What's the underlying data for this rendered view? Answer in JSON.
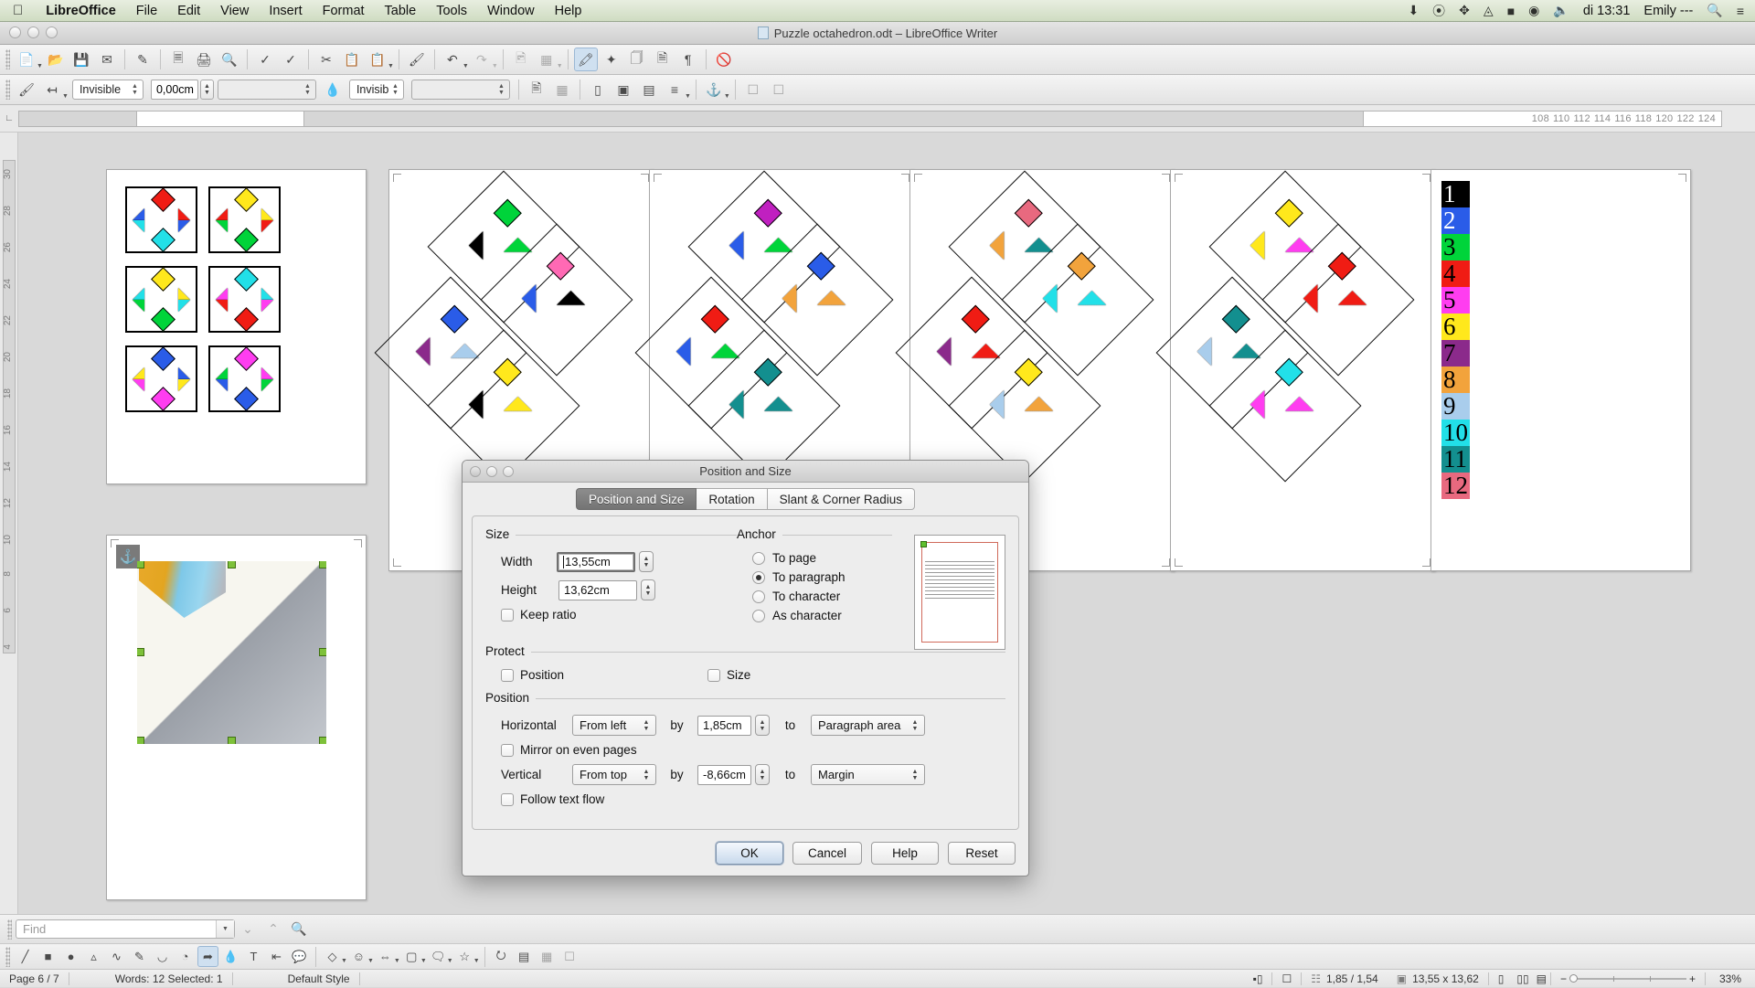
{
  "macmenu": {
    "apple": "apple-logo",
    "items": [
      "LibreOffice",
      "File",
      "Edit",
      "View",
      "Insert",
      "Format",
      "Table",
      "Tools",
      "Window",
      "Help"
    ],
    "tray_icons": [
      "download-icon",
      "dropbox-icon",
      "bluetooth-icon",
      "wifi-icon",
      "battery-icon",
      "clock-icon",
      "volume-icon"
    ],
    "clock": "di 13:31",
    "user": "Emily ---",
    "search_icon": "search-icon",
    "list_icon": "list-icon"
  },
  "window": {
    "title": "Puzzle octahedron.odt – LibreOffice Writer"
  },
  "toolbar2": {
    "line_style": "Invisible",
    "line_width": "0,00cm",
    "line_color": "",
    "area_style": "Invisib",
    "area_fill": ""
  },
  "ruler": {
    "ticks": [
      "108",
      "110",
      "112",
      "114",
      "116",
      "118",
      "120",
      "122",
      "124"
    ],
    "vticks": [
      "4",
      "6",
      "8",
      "10",
      "12",
      "14",
      "16",
      "18",
      "20",
      "22",
      "24",
      "26",
      "28",
      "30"
    ]
  },
  "numbers_column": [
    {
      "label": "1",
      "bg": "#000000",
      "fg": "#ffffff"
    },
    {
      "label": "2",
      "bg": "#2a5ce8",
      "fg": "#ffffff"
    },
    {
      "label": "3",
      "bg": "#00d43a",
      "fg": "#000000"
    },
    {
      "label": "4",
      "bg": "#f01c14",
      "fg": "#000000"
    },
    {
      "label": "5",
      "bg": "#ff3df0",
      "fg": "#000000"
    },
    {
      "label": "6",
      "bg": "#ffe81c",
      "fg": "#000000"
    },
    {
      "label": "7",
      "bg": "#8b2a8b",
      "fg": "#000000"
    },
    {
      "label": "8",
      "bg": "#f2a33c",
      "fg": "#000000"
    },
    {
      "label": "9",
      "bg": "#a9cdec",
      "fg": "#000000"
    },
    {
      "label": "10",
      "bg": "#22e0e8",
      "fg": "#000000"
    },
    {
      "label": "11",
      "bg": "#138f8f",
      "fg": "#000000"
    },
    {
      "label": "12",
      "bg": "#e8697f",
      "fg": "#000000"
    }
  ],
  "find": {
    "placeholder": "Find",
    "down_icon": "find-next-icon",
    "up_icon": "find-previous-icon",
    "dialog_icon": "find-and-replace-icon"
  },
  "statusbar": {
    "page": "Page 6 / 7",
    "words": "Words: 12 Selected: 1",
    "style": "Default Style",
    "selection_mode_icon": "selection-mode-icon",
    "modified_icon": "document-modified-icon",
    "position": "1,85 / 1,54",
    "size": "13,55 x 13,62",
    "view_single_icon": "single-page-view-icon",
    "view_multi_icon": "multi-page-view-icon",
    "view_book_icon": "book-view-icon",
    "zoom_minus": "−",
    "zoom_plus": "+",
    "zoom": "33%"
  },
  "dialog": {
    "title": "Position and Size",
    "tabs": [
      {
        "label": "Position and Size",
        "selected": true
      },
      {
        "label": "Rotation",
        "selected": false
      },
      {
        "label": "Slant & Corner Radius",
        "selected": false
      }
    ],
    "size": {
      "group": "Size",
      "width_label": "Width",
      "width_value": "13,55cm",
      "height_label": "Height",
      "height_value": "13,62cm",
      "keep_ratio_label": "Keep ratio",
      "keep_ratio_checked": false
    },
    "anchor": {
      "group": "Anchor",
      "options": [
        {
          "label": "To page",
          "selected": false
        },
        {
          "label": "To paragraph",
          "selected": true
        },
        {
          "label": "To character",
          "selected": false
        },
        {
          "label": "As character",
          "selected": false
        }
      ]
    },
    "protect": {
      "group": "Protect",
      "position_label": "Position",
      "position_checked": false,
      "size_label": "Size",
      "size_checked": false
    },
    "position": {
      "group": "Position",
      "horizontal_label": "Horizontal",
      "horizontal_value": "From left",
      "horizontal_by_label": "by",
      "horizontal_by_value": "1,85cm",
      "horizontal_to_label": "to",
      "horizontal_to_value": "Paragraph area",
      "mirror_label": "Mirror on even pages",
      "mirror_checked": false,
      "vertical_label": "Vertical",
      "vertical_value": "From top",
      "vertical_by_label": "by",
      "vertical_by_value": "-8,66cm",
      "vertical_to_label": "to",
      "vertical_to_value": "Margin",
      "follow_label": "Follow text flow",
      "follow_checked": false
    },
    "buttons": {
      "ok": "OK",
      "cancel": "Cancel",
      "help": "Help",
      "reset": "Reset"
    }
  },
  "document": {
    "anchor_icon": "anchor-icon",
    "cards": [
      {
        "top": "#f01c14",
        "bottom": "#22e0e8",
        "lu": "#2a5ce8",
        "ld": "#22e0e8",
        "ru": "#f01c14",
        "rd": "#2a5ce8"
      },
      {
        "top": "#ffe81c",
        "bottom": "#00d43a",
        "lu": "#f01c14",
        "ld": "#00d43a",
        "ru": "#ffe81c",
        "rd": "#f01c14"
      },
      {
        "top": "#ffe81c",
        "bottom": "#00d43a",
        "lu": "#22e0e8",
        "ld": "#00d43a",
        "ru": "#ffe81c",
        "rd": "#22e0e8"
      },
      {
        "top": "#22e0e8",
        "bottom": "#f01c14",
        "lu": "#ff3df0",
        "ld": "#f01c14",
        "ru": "#22e0e8",
        "rd": "#ff3df0"
      },
      {
        "top": "#2a5ce8",
        "bottom": "#ff3df0",
        "lu": "#ffe81c",
        "ld": "#ff3df0",
        "ru": "#2a5ce8",
        "rd": "#ffe81c"
      },
      {
        "top": "#ff3df0",
        "bottom": "#2a5ce8",
        "lu": "#00d43a",
        "ld": "#2a5ce8",
        "ru": "#ff3df0",
        "rd": "#00d43a"
      }
    ],
    "nets": [
      {
        "colors": [
          "#00d43a",
          "#00d43a",
          "#000000",
          "#ff69b4",
          "#000000",
          "#2a5ce8",
          "#2a5ce8",
          "#a9cdec",
          "#8b2a8b",
          "#ffe81c",
          "#ffe81c",
          "#000000"
        ]
      },
      {
        "colors": [
          "#c020c0",
          "#00d43a",
          "#2a5ce8",
          "#2a5ce8",
          "#f2a33c",
          "#f2a33c",
          "#f01c14",
          "#00d43a",
          "#2a5ce8",
          "#138f8f",
          "#138f8f",
          "#138f8f"
        ]
      },
      {
        "colors": [
          "#e8697f",
          "#138f8f",
          "#f2a33c",
          "#f2a33c",
          "#22e0e8",
          "#22e0e8",
          "#f01c14",
          "#f01c14",
          "#8b2a8b",
          "#ffe81c",
          "#f2a33c",
          "#a9cdec"
        ]
      },
      {
        "colors": [
          "#ffe81c",
          "#ff3df0",
          "#ffe81c",
          "#f01c14",
          "#f01c14",
          "#f01c14",
          "#138f8f",
          "#138f8f",
          "#a9cdec",
          "#22e0e8",
          "#ff3df0",
          "#ff3df0"
        ]
      }
    ]
  }
}
